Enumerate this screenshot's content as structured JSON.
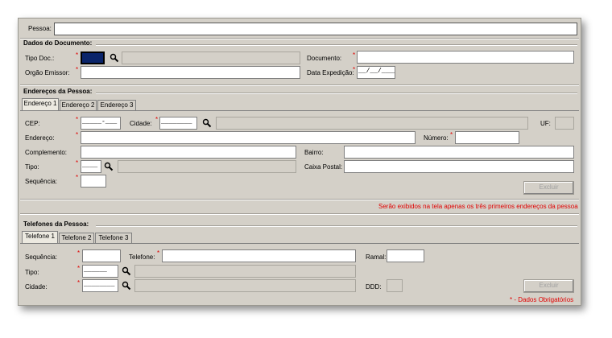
{
  "pessoa": {
    "label": "Pessoa:",
    "value": ""
  },
  "documento": {
    "section_title": "Dados do Documento:",
    "tipo_doc_label": "Tipo Doc.:",
    "documento_label": "Documento:",
    "orgao_label": "Orgão Emissor:",
    "data_label": "Data Expedição:",
    "data_mask": "__/__/____"
  },
  "enderecos": {
    "section_title": "Endereços da Pessoa:",
    "tabs": [
      "Endereço 1",
      "Endereço 2",
      "Endereço 3"
    ],
    "cep_label": "CEP:",
    "cep_mask": "_____-___",
    "cidade_label": "Cidade:",
    "cidade_mask": "________",
    "uf_label": "UF:",
    "endereco_label": "Endereço:",
    "numero_label": "Número:",
    "complemento_label": "Complemento:",
    "bairro_label": "Bairro:",
    "tipo_label": "Tipo:",
    "tipo_mask": "____",
    "caixa_postal_label": "Caixa Postal:",
    "sequencia_label": "Sequência:",
    "excluir_label": "Excluir",
    "note": "Serão exibidos na tela apenas os três primeiros endereços da pessoa"
  },
  "telefones": {
    "section_title": "Telefones da Pessoa:",
    "tabs": [
      "Telefone 1",
      "Telefone 2",
      "Telefone 3"
    ],
    "sequencia_label": "Sequência:",
    "telefone_label": "Telefone:",
    "ramal_label": "Ramal:",
    "tipo_label": "Tipo:",
    "tipo_mask": "______",
    "cidade_label": "Cidade:",
    "cidade_mask": "________",
    "ddd_label": "DDD:",
    "excluir_label": "Excluir",
    "obrigatorios": "* - Dados Obrigatórios"
  },
  "required_mark": "*",
  "colors": {
    "background": "#d4d0c8",
    "required": "#e00000",
    "focus": "#0a246a"
  }
}
